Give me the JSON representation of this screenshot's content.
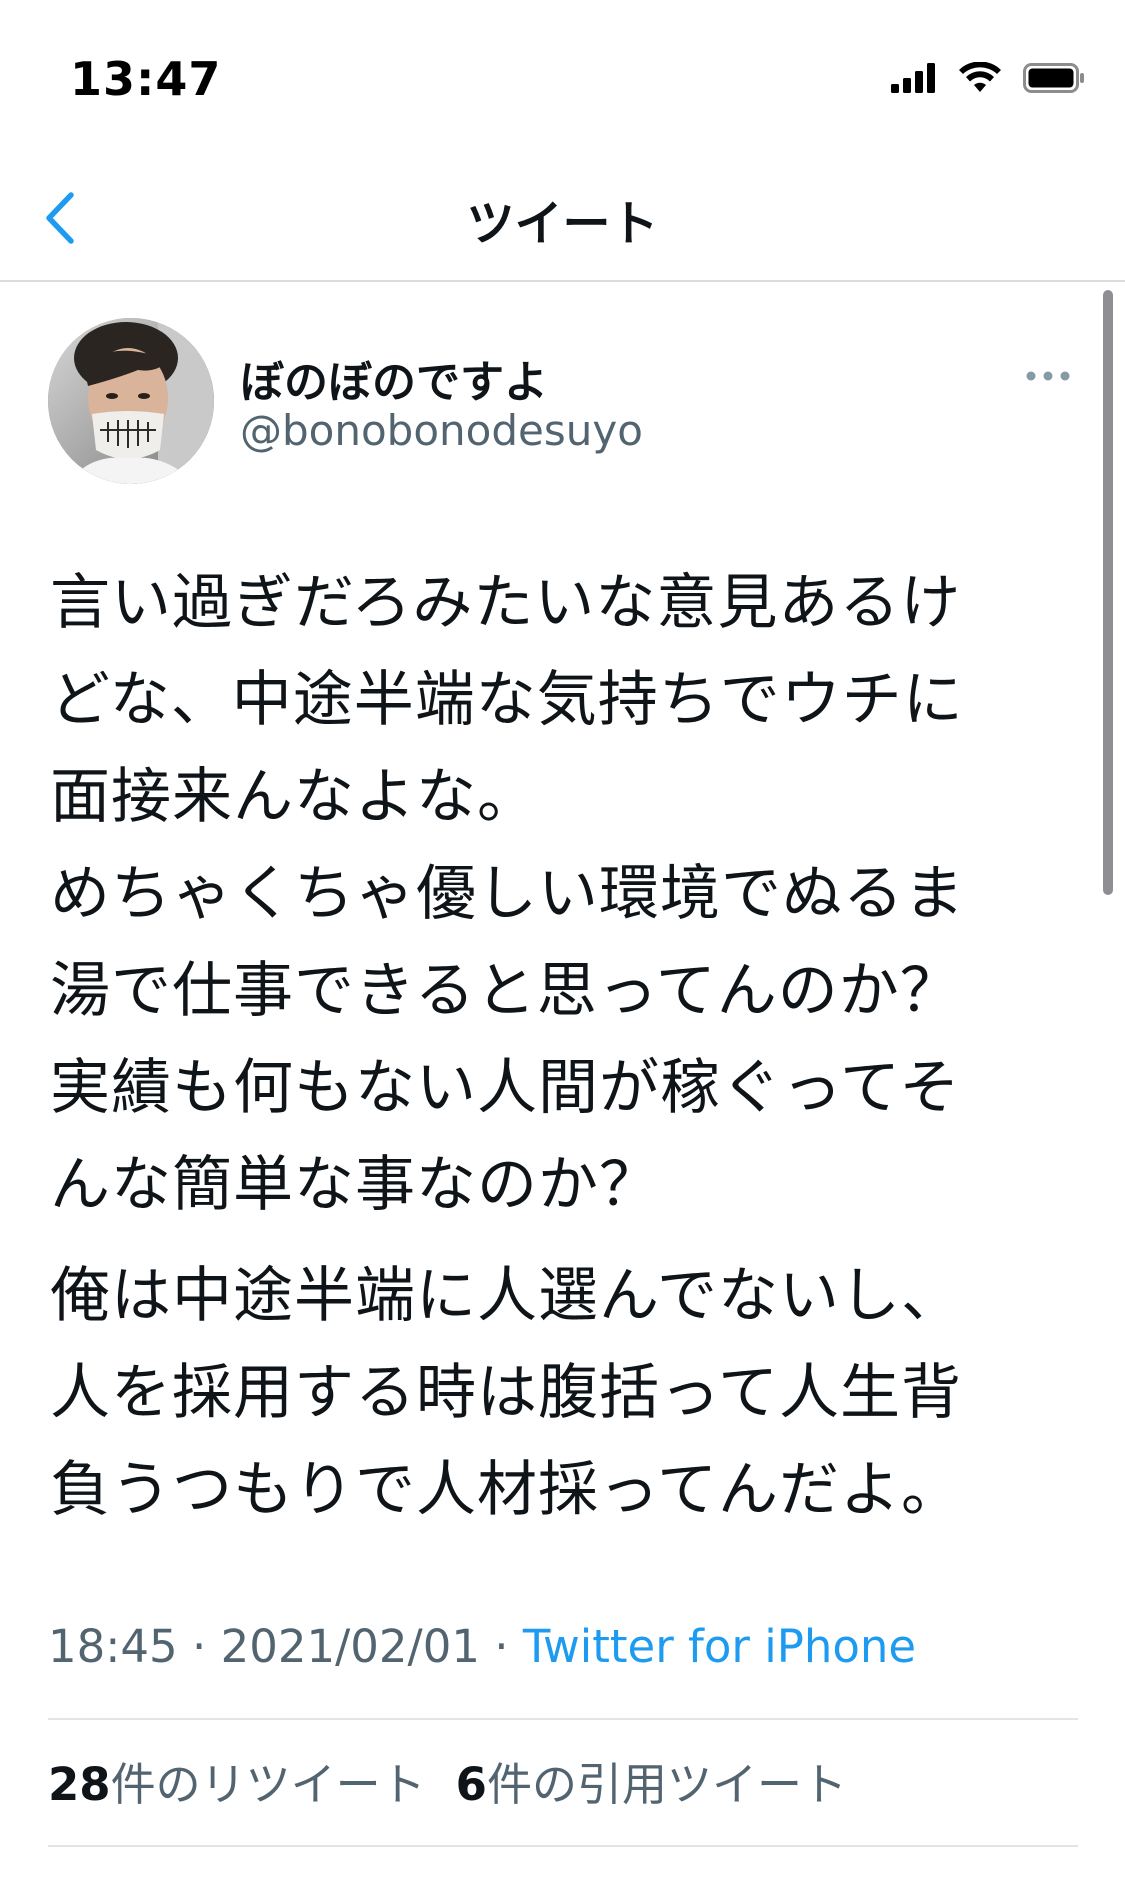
{
  "status_bar": {
    "time": "13:47",
    "icons": [
      "cellular-signal-icon",
      "wifi-icon",
      "battery-icon"
    ]
  },
  "nav": {
    "back_icon": "chevron-left-icon",
    "title": "ツイート"
  },
  "author": {
    "display_name": "ぼのぼのですよ",
    "handle": "@bonobonodesuyo",
    "more_icon": "more-horizontal-icon"
  },
  "tweet": {
    "paragraph_1": "言い過ぎだろみたいな意見あるけ\nどな、中途半端な気持ちでウチに\n面接来んなよな。\nめちゃくちゃ優しい環境でぬるま\n湯で仕事できると思ってんのか？\n実績も何もない人間が稼ぐってそ\nんな簡単な事なのか？",
    "paragraph_2": "俺は中途半端に人選んでないし、\n人を採用する時は腹括って人生背\n負うつもりで人材採ってんだよ。"
  },
  "meta": {
    "time": "18:45",
    "sep_1": " · ",
    "date": "2021/02/01",
    "sep_2": " · ",
    "source": "Twitter for iPhone"
  },
  "stats": {
    "retweets_count": "28",
    "retweets_label": "件のリツイート",
    "quotes_count": "6",
    "quotes_label": "件の引用ツイート"
  },
  "colors": {
    "accent": "#1d9bf0",
    "secondary_text": "#536471",
    "primary_text": "#0f1419"
  }
}
